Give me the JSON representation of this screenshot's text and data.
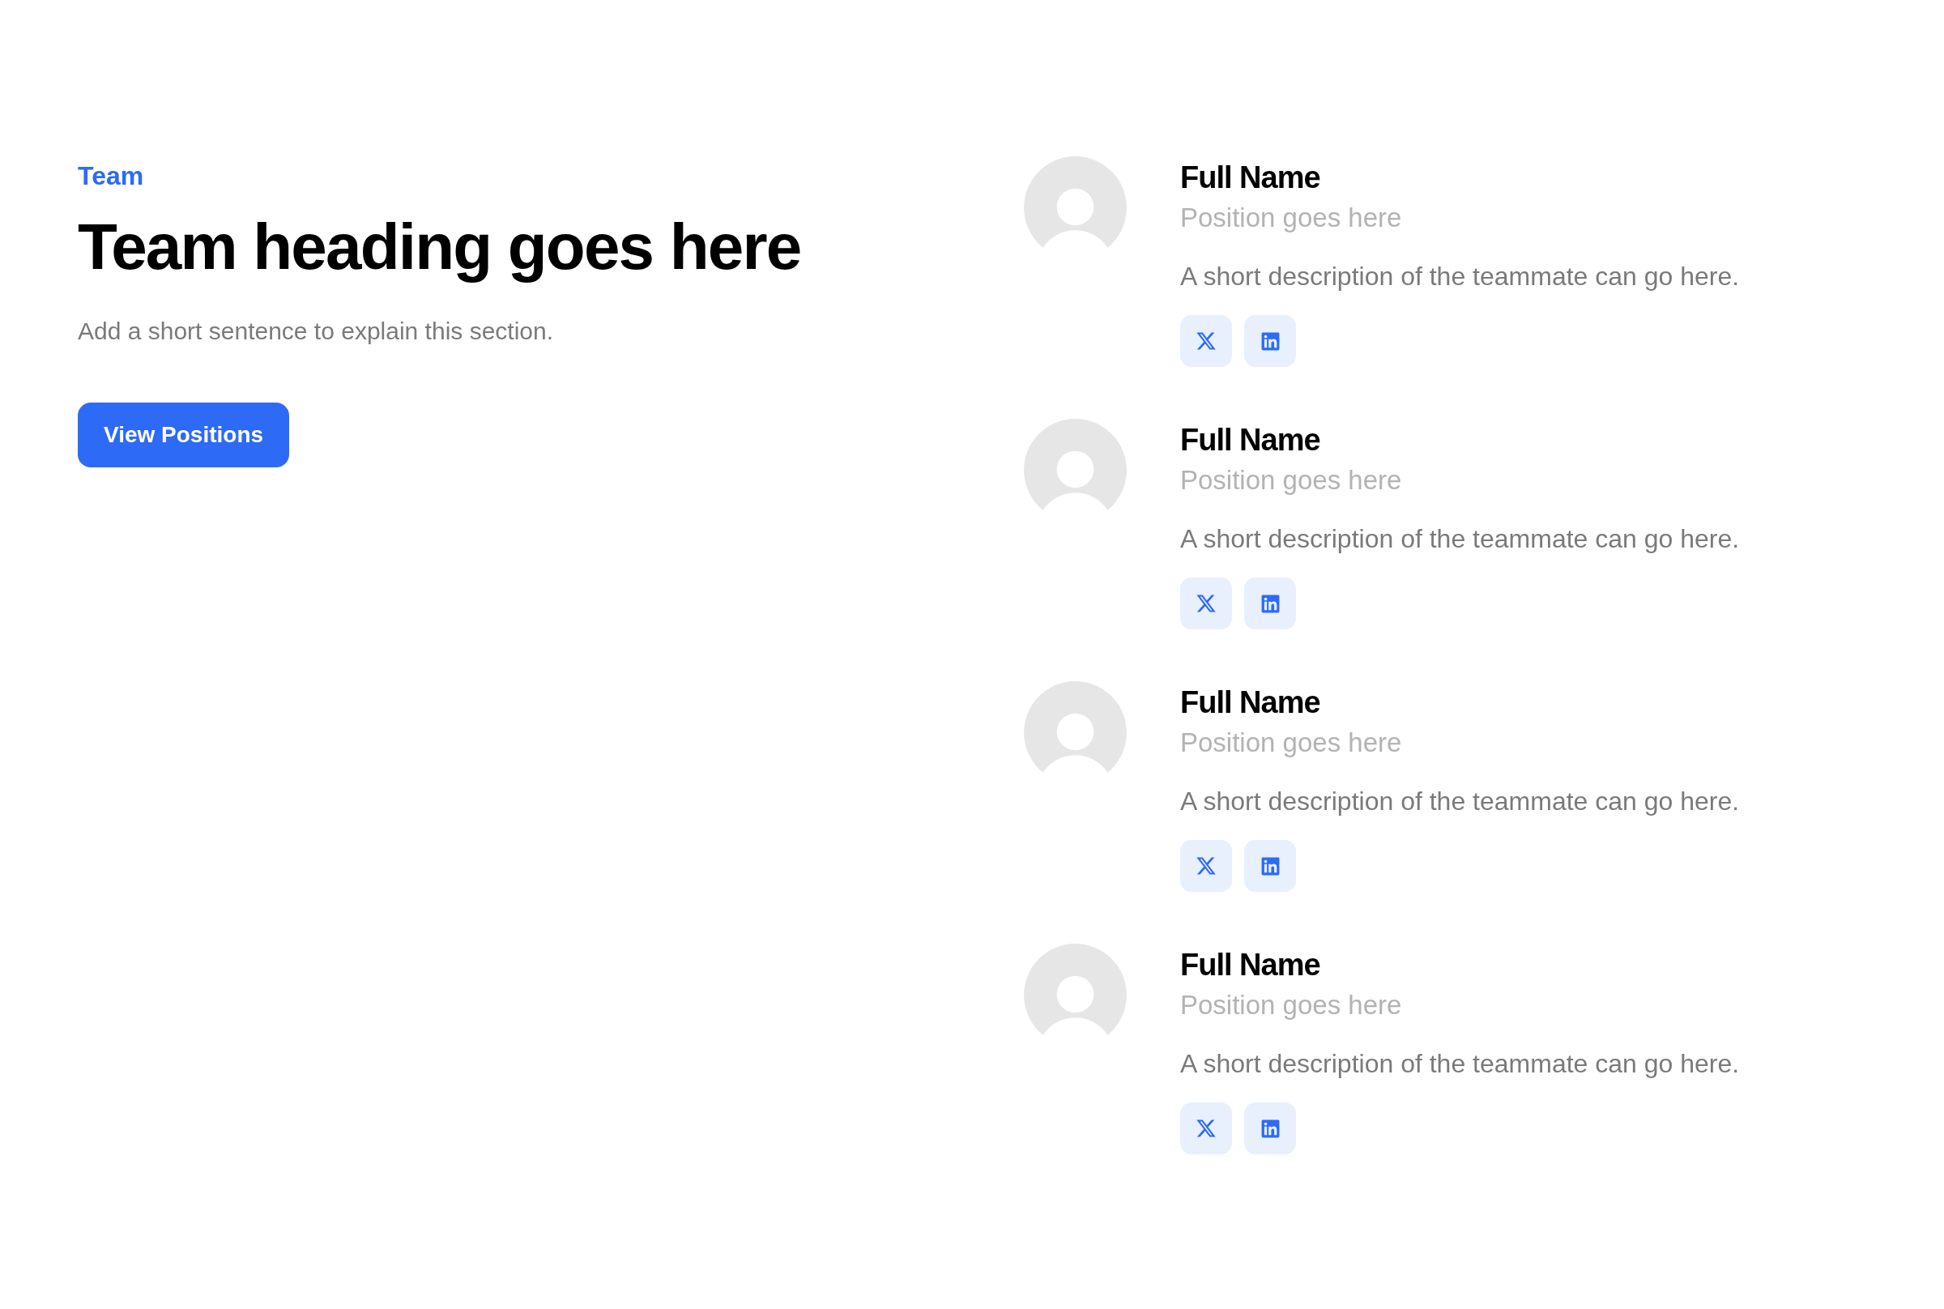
{
  "section": {
    "eyebrow": "Team",
    "heading": "Team heading goes here",
    "subheading": "Add a short sentence to explain this section.",
    "button": "View Positions"
  },
  "members": [
    {
      "name": "Full Name",
      "position": "Position goes here",
      "description": "A short description of the teammate can go here."
    },
    {
      "name": "Full Name",
      "position": "Position goes here",
      "description": "A short description of the teammate can go here."
    },
    {
      "name": "Full Name",
      "position": "Position goes here",
      "description": "A short description of the teammate can go here."
    },
    {
      "name": "Full Name",
      "position": "Position goes here",
      "description": "A short description of the teammate can go here."
    }
  ]
}
